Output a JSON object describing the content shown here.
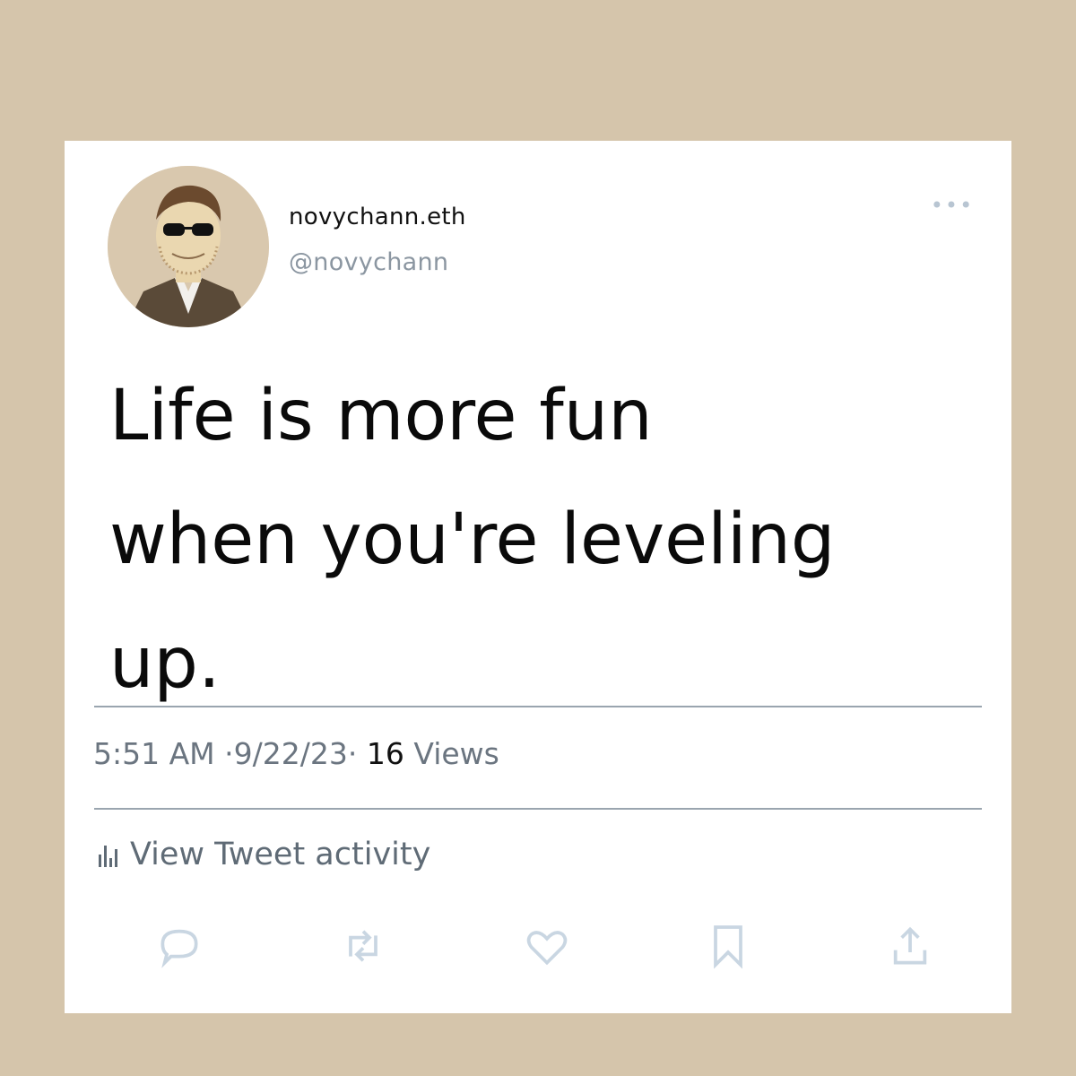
{
  "tweet": {
    "display_name": "novychann.eth",
    "handle": "@novychann",
    "text_lines": [
      "Life is more fun",
      "when you're leveling",
      "up."
    ],
    "time": "5:51 AM",
    "date": "9/22/23",
    "views_count": "16",
    "views_label": "Views",
    "activity_label": "View Tweet activity"
  },
  "icons": {
    "more": "more-horizontal-icon",
    "reply": "reply-icon",
    "retweet": "retweet-icon",
    "like": "heart-icon",
    "bookmark": "bookmark-icon",
    "share": "share-icon",
    "activity": "bar-chart-icon"
  },
  "colors": {
    "background": "#d5c5ab",
    "card": "#ffffff",
    "text": "#0a0a0a",
    "muted": "#8b96a1",
    "icon_faint": "#c9d6e2"
  }
}
